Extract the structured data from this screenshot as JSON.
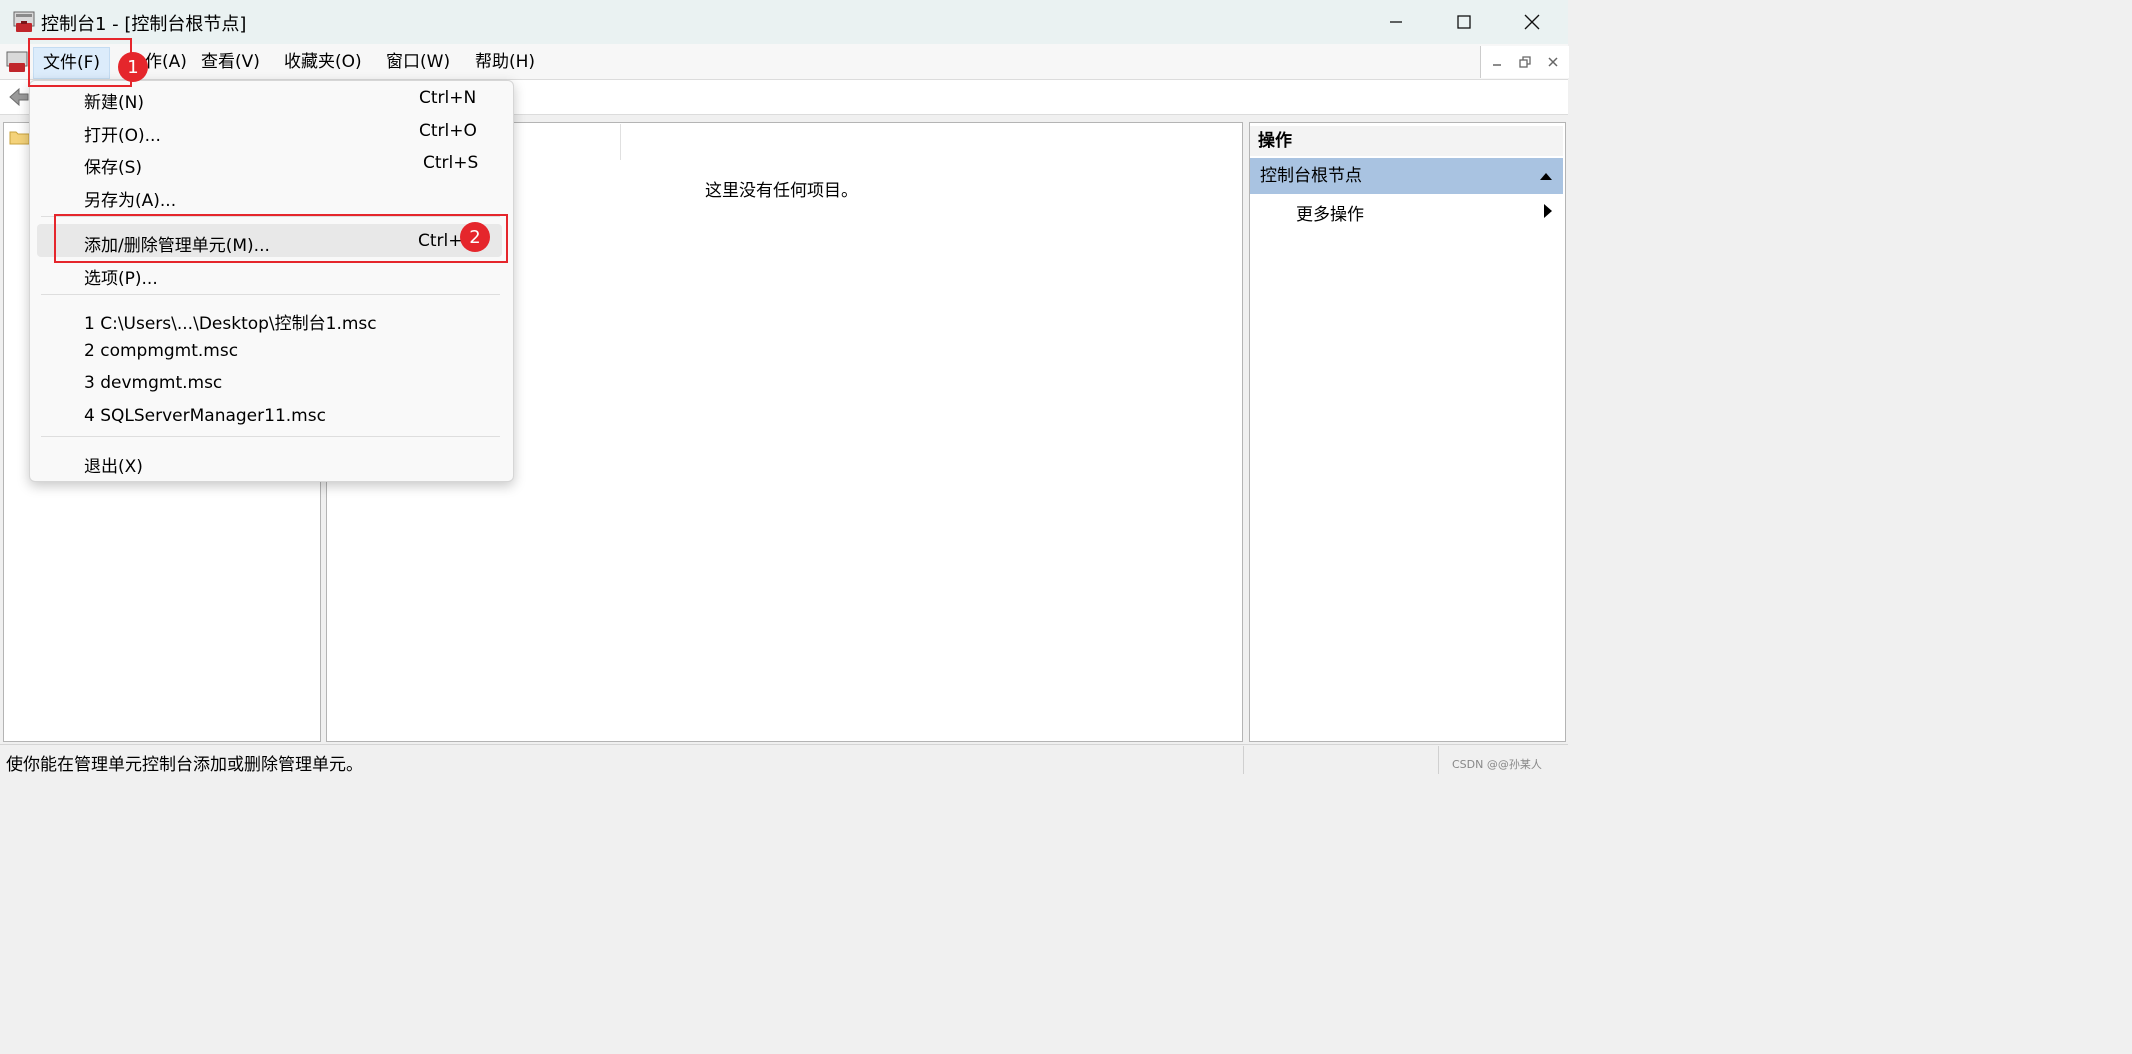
{
  "window": {
    "title": "控制台1 - [控制台根节点]"
  },
  "menubar": {
    "items": [
      {
        "label": "文件(F)"
      },
      {
        "label": "作(A)"
      },
      {
        "label": "查看(V)"
      },
      {
        "label": "收藏夹(O)"
      },
      {
        "label": "窗口(W)"
      },
      {
        "label": "帮助(H)"
      }
    ]
  },
  "file_menu": {
    "items": [
      {
        "label": "新建(N)",
        "shortcut": "Ctrl+N"
      },
      {
        "label": "打开(O)...",
        "shortcut": "Ctrl+O"
      },
      {
        "label": "保存(S)",
        "shortcut": "Ctrl+S"
      },
      {
        "label": "另存为(A)...",
        "shortcut": ""
      },
      {
        "label": "添加/删除管理单元(M)...",
        "shortcut": "Ctrl+"
      },
      {
        "label": "选项(P)...",
        "shortcut": ""
      },
      {
        "label": "1 C:\\Users\\...\\Desktop\\控制台1.msc",
        "shortcut": ""
      },
      {
        "label": "2 compmgmt.msc",
        "shortcut": ""
      },
      {
        "label": "3 devmgmt.msc",
        "shortcut": ""
      },
      {
        "label": "4 SQLServerManager11.msc",
        "shortcut": ""
      },
      {
        "label": "退出(X)",
        "shortcut": ""
      }
    ],
    "highlighted_item": "添加/删除管理单元(M)..."
  },
  "result_pane": {
    "empty_message": "这里没有任何项目。"
  },
  "actions_pane": {
    "header": "操作",
    "section": "控制台根节点",
    "items": [
      {
        "label": "更多操作"
      }
    ]
  },
  "status_bar": {
    "text": "使你能在管理单元控制台添加或删除管理单元。"
  },
  "watermark": "CSDN @@孙某人",
  "annotations": {
    "badges": [
      {
        "label": "1"
      },
      {
        "label": "2"
      }
    ],
    "color": "#e5262c"
  }
}
